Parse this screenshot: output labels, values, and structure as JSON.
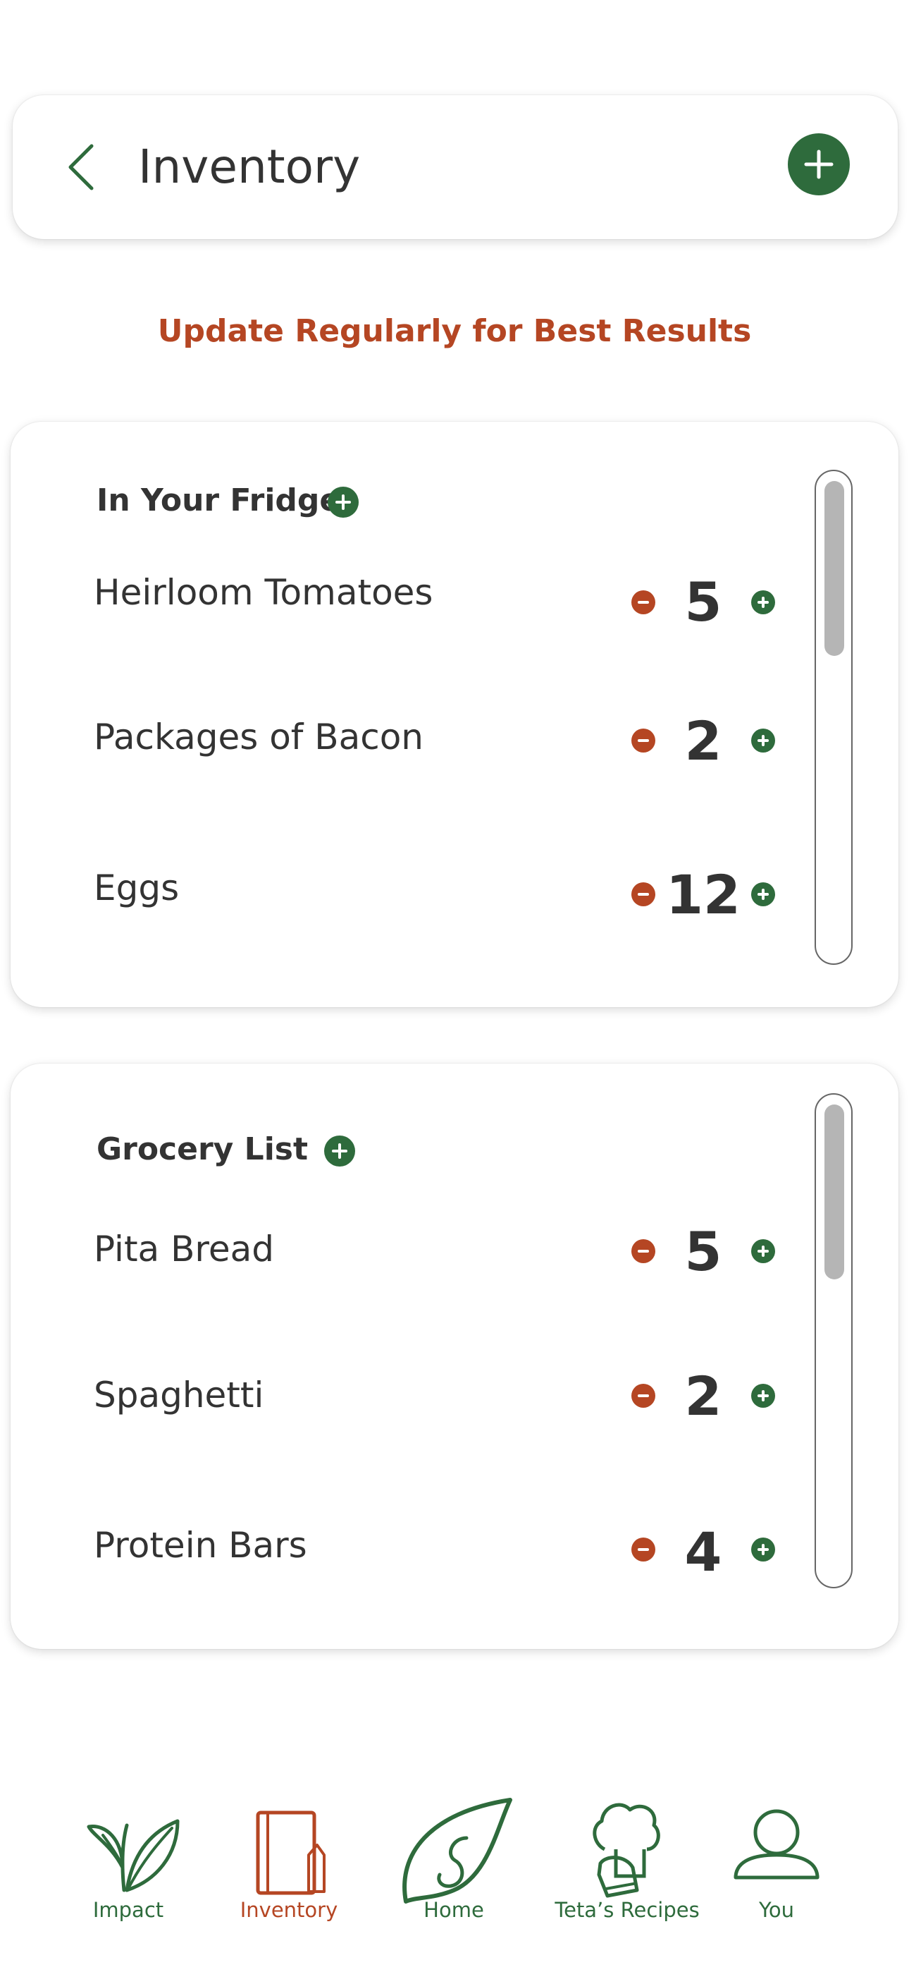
{
  "header": {
    "title": "Inventory"
  },
  "subtitle": "Update Regularly for Best Results",
  "fridge": {
    "title": "In Your Fridge",
    "items": [
      {
        "name": "Heirloom Tomatoes",
        "qty": "5"
      },
      {
        "name": "Packages of Bacon",
        "qty": "2"
      },
      {
        "name": "Eggs",
        "qty": "12"
      }
    ]
  },
  "grocery": {
    "title": "Grocery List",
    "items": [
      {
        "name": "Pita Bread",
        "qty": "5"
      },
      {
        "name": "Spaghetti",
        "qty": "2"
      },
      {
        "name": "Protein Bars",
        "qty": "4"
      }
    ]
  },
  "nav": {
    "items": [
      {
        "label": "Impact",
        "icon": "sprout-icon"
      },
      {
        "label": "Inventory",
        "icon": "notebook-icon",
        "active": true
      },
      {
        "label": "Home",
        "icon": "leaf-icon"
      },
      {
        "label": "Teta’s Recipes",
        "icon": "chef-oven-mitt-icon"
      },
      {
        "label": "You",
        "icon": "person-icon"
      }
    ]
  },
  "colors": {
    "primary_green": "#2e6b3c",
    "accent_orange": "#b54623",
    "text_dark": "#333333",
    "scroll_thumb": "#b5b5b5"
  }
}
